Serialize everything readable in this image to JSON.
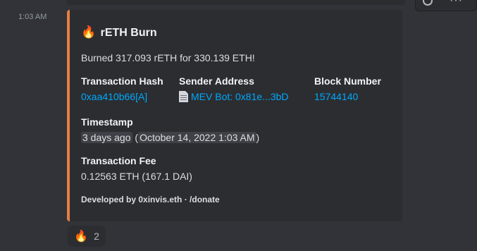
{
  "message": {
    "time": "1:03 AM"
  },
  "embed": {
    "accent_color": "#e67e44",
    "title_icon": "fire-emoji",
    "title_emoji": "🔥",
    "title": "rETH Burn",
    "description": "Burned 317.093 rETH for 330.139 ETH!",
    "fields": {
      "tx_hash": {
        "name": "Transaction Hash",
        "value": "0xaa410b66[A]"
      },
      "sender": {
        "name": "Sender Address",
        "icon": "document-icon",
        "value": "MEV Bot: 0x81e...3bD"
      },
      "block": {
        "name": "Block Number",
        "value": "15744140"
      },
      "timestamp": {
        "name": "Timestamp",
        "relative": "3 days ago",
        "absolute": "October 14, 2022 1:03 AM"
      },
      "fee": {
        "name": "Transaction Fee",
        "value": "0.12563 ETH (167.1 DAI)"
      }
    },
    "footer": "Developed by 0xinvis.eth · /donate"
  },
  "reaction": {
    "emoji": "🔥",
    "count": "2"
  }
}
